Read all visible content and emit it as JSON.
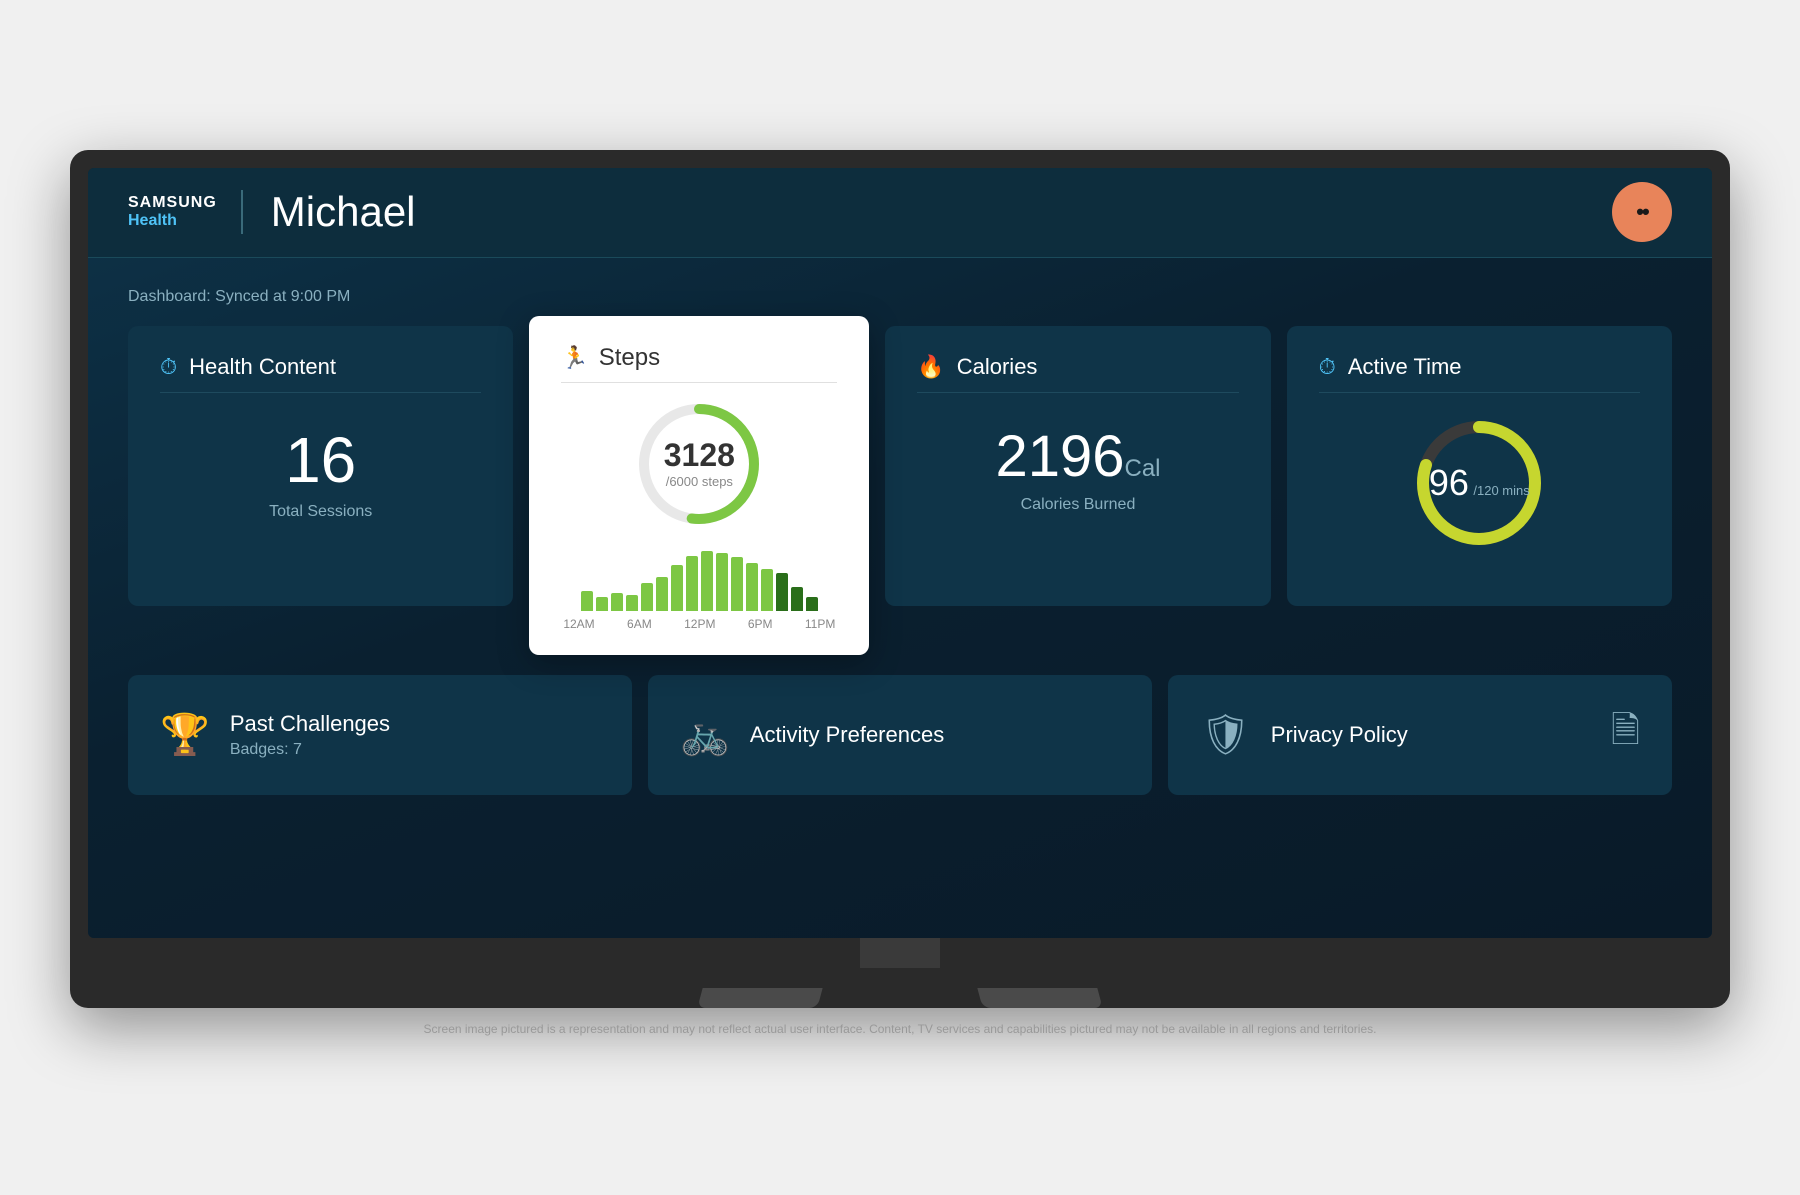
{
  "header": {
    "logo_samsung": "SAMSUNG",
    "logo_health": "Health",
    "user_name": "Michael",
    "avatar_dots": "••"
  },
  "dashboard": {
    "sync_text": "Dashboard: Synced at 9:00 PM",
    "health_content": {
      "title": "Health Content",
      "value": "16",
      "label": "Total Sessions"
    },
    "steps": {
      "title": "Steps",
      "value": "3128",
      "goal": "/6000 steps",
      "bars": [
        20,
        15,
        22,
        18,
        35,
        40,
        55,
        60,
        65,
        62,
        58,
        50,
        45,
        42,
        30,
        20
      ],
      "labels": [
        "12AM",
        "6AM",
        "12PM",
        "6PM",
        "11PM"
      ],
      "progress_pct": 52
    },
    "calories": {
      "title": "Calories",
      "value": "2196",
      "unit": "Cal",
      "label": "Calories Burned"
    },
    "active_time": {
      "title": "Active Time",
      "value": "96",
      "goal": "/120 mins",
      "progress_pct": 80
    }
  },
  "bottom_cards": {
    "past_challenges": {
      "title": "Past Challenges",
      "subtitle": "Badges: 7"
    },
    "activity_preferences": {
      "title": "Activity Preferences"
    },
    "privacy_policy": {
      "title": "Privacy Policy"
    }
  },
  "disclaimer": "Screen image pictured is a representation and may not reflect actual user interface. Content, TV services and capabilities pictured may not be available in all regions and territories."
}
